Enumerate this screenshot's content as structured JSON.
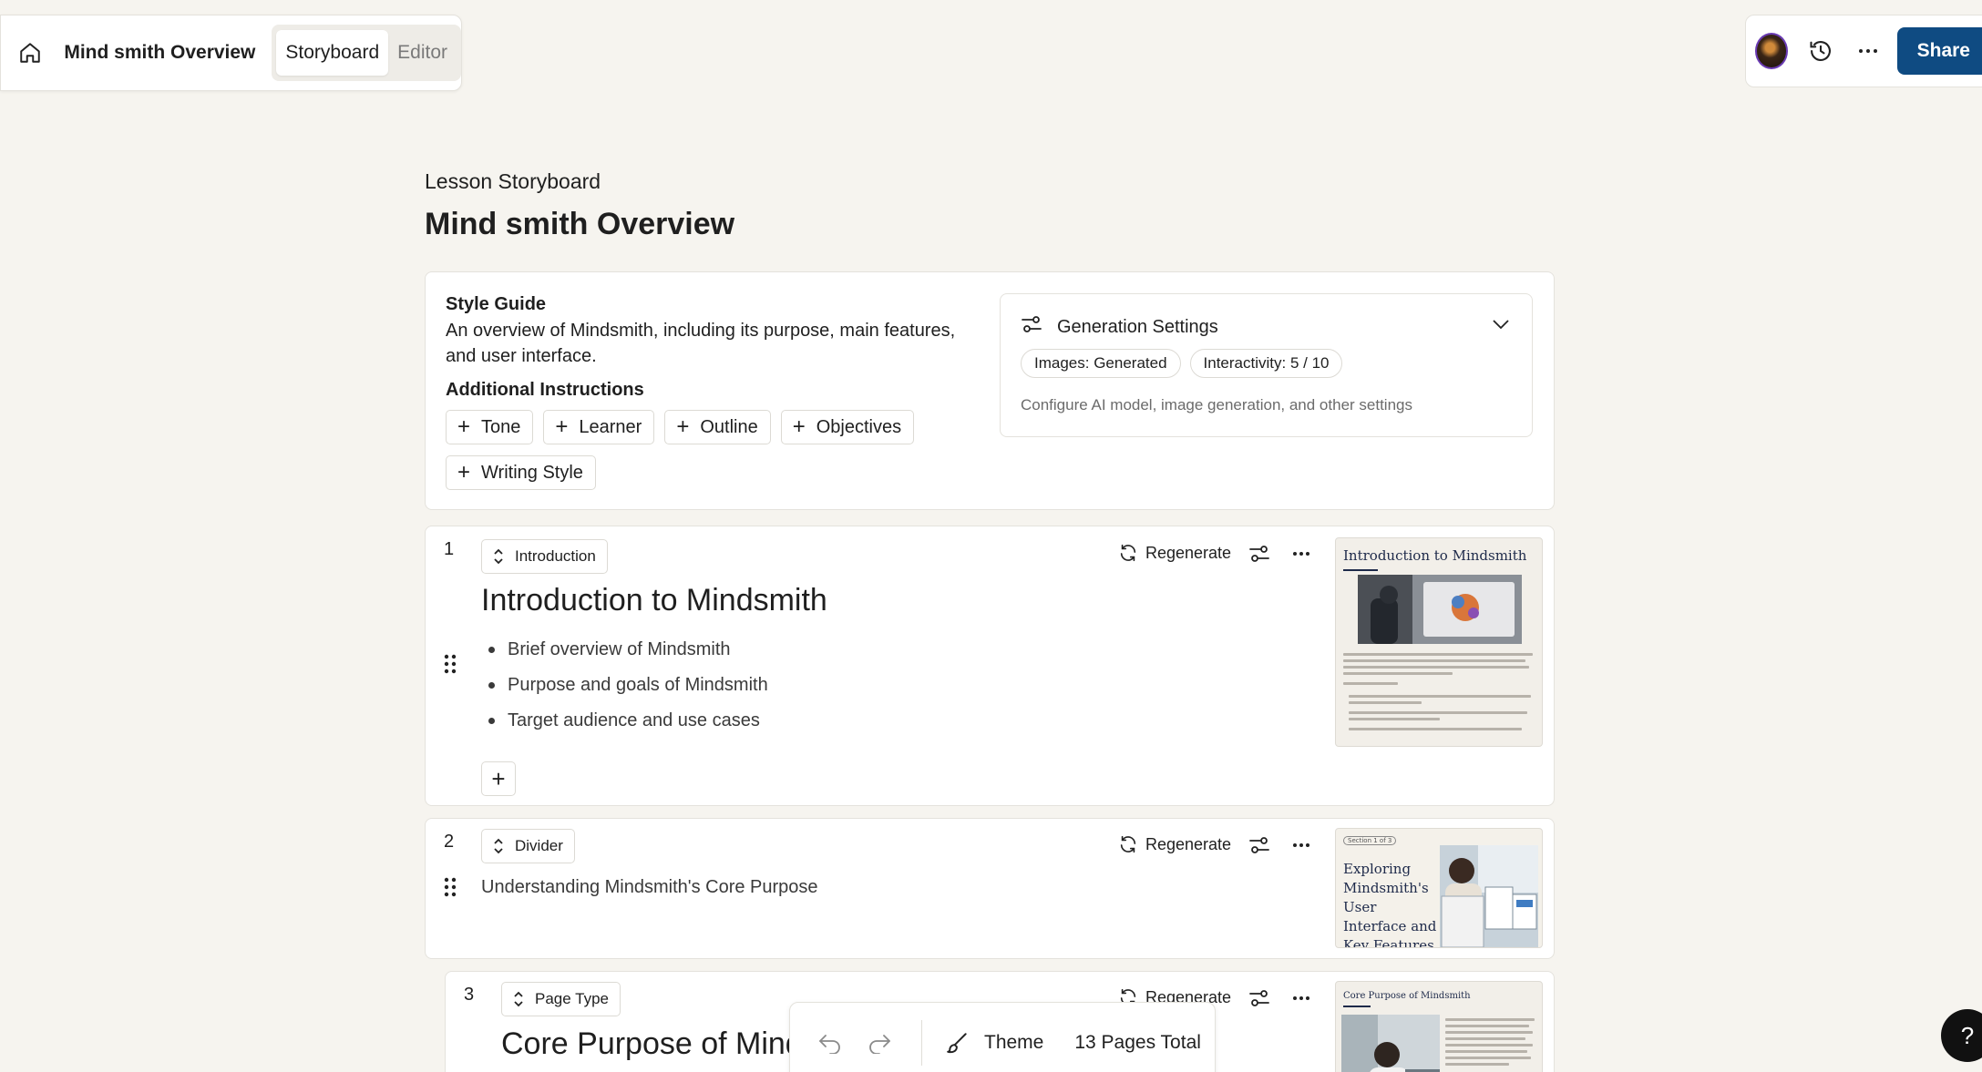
{
  "header": {
    "doc_title": "Mind smith Overview",
    "tabs": [
      "Storyboard",
      "Editor"
    ],
    "share_label": "Share"
  },
  "eyebrow": "Lesson Storyboard",
  "title": "Mind smith Overview",
  "style_guide": {
    "heading": "Style Guide",
    "description": "An overview of Mindsmith, including its purpose, main features, and user interface.",
    "additional_heading": "Additional Instructions",
    "chips": [
      "Tone",
      "Learner",
      "Outline",
      "Objectives",
      "Writing Style"
    ]
  },
  "generation": {
    "heading": "Generation Settings",
    "pills": [
      "Images: Generated",
      "Interactivity: 5 / 10"
    ],
    "subtitle": "Configure AI model, image generation, and other settings"
  },
  "pages": [
    {
      "number": "1",
      "type": "Introduction",
      "regenerate": "Regenerate",
      "title": "Introduction to Mindsmith",
      "bullets": [
        "Brief overview of Mindsmith",
        "Purpose and goals of Mindsmith",
        "Target audience and use cases"
      ],
      "thumb_title": "Introduction to Mindsmith"
    },
    {
      "number": "2",
      "type": "Divider",
      "regenerate": "Regenerate",
      "subtitle": "Understanding Mindsmith's Core Purpose",
      "thumb_badge": "Section 1 of 3",
      "thumb_title": "Exploring Mindsmith's User Interface and Key Features"
    },
    {
      "number": "3",
      "type": "Page Type",
      "regenerate": "Regenerate",
      "title": "Core Purpose of Minds",
      "thumb_title": "Core Purpose of Mindsmith"
    }
  ],
  "bottom_bar": {
    "theme_label": "Theme",
    "pages_total": "13 Pages Total"
  },
  "help_label": "?",
  "colors": {
    "share": "#0f4b82",
    "background": "#f6f4ef"
  }
}
